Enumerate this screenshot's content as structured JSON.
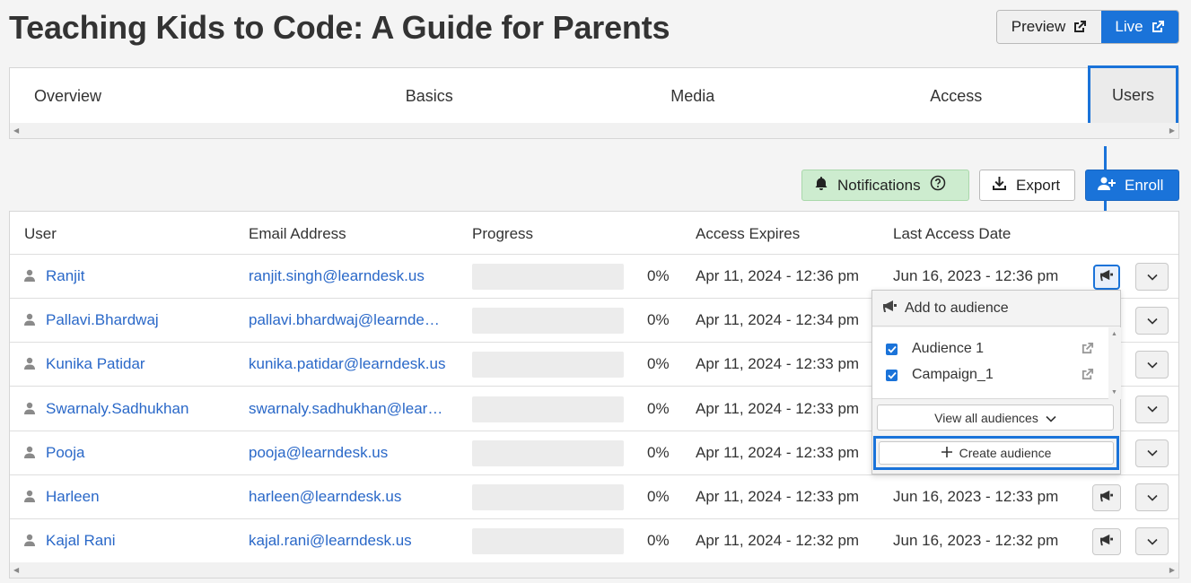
{
  "page": {
    "title": "Teaching Kids to Code: A Guide for Parents",
    "preview_label": "Preview",
    "live_label": "Live"
  },
  "tabs": {
    "items": [
      "Overview",
      "Basics",
      "Media",
      "Access"
    ],
    "active": "Users"
  },
  "actions": {
    "notifications_label": "Notifications",
    "export_label": "Export",
    "enroll_label": "Enroll"
  },
  "table": {
    "headers": {
      "user": "User",
      "email": "Email Address",
      "progress": "Progress",
      "expires": "Access Expires",
      "last": "Last Access Date"
    },
    "rows": [
      {
        "user": "Ranjit",
        "email": "ranjit.singh@learndesk.us",
        "progress": "0%",
        "expires": "Apr 11, 2024 - 12:36 pm",
        "last": "Jun 16, 2023 - 12:36 pm"
      },
      {
        "user": "Pallavi.Bhardwaj",
        "email": "pallavi.bhardwaj@learndesk.us",
        "progress": "0%",
        "expires": "Apr 11, 2024 - 12:34 pm",
        "last": ""
      },
      {
        "user": "Kunika Patidar",
        "email": "kunika.patidar@learndesk.us",
        "progress": "0%",
        "expires": "Apr 11, 2024 - 12:33 pm",
        "last": ""
      },
      {
        "user": "Swarnaly.Sadhukhan",
        "email": "swarnaly.sadhukhan@learndesk.us",
        "progress": "0%",
        "expires": "Apr 11, 2024 - 12:33 pm",
        "last": ""
      },
      {
        "user": "Pooja",
        "email": "pooja@learndesk.us",
        "progress": "0%",
        "expires": "Apr 11, 2024 - 12:33 pm",
        "last": ""
      },
      {
        "user": "Harleen",
        "email": "harleen@learndesk.us",
        "progress": "0%",
        "expires": "Apr 11, 2024 - 12:33 pm",
        "last": "Jun 16, 2023 - 12:33 pm"
      },
      {
        "user": "Kajal Rani",
        "email": "kajal.rani@learndesk.us",
        "progress": "0%",
        "expires": "Apr 11, 2024 - 12:32 pm",
        "last": "Jun 16, 2023 - 12:32 pm"
      }
    ]
  },
  "audience_popup": {
    "title": "Add to audience",
    "items": [
      {
        "label": "Audience 1",
        "checked": true
      },
      {
        "label": "Campaign_1",
        "checked": true
      }
    ],
    "view_all_label": "View all audiences",
    "create_label": "Create audience"
  },
  "colors": {
    "accent": "#1a73d9",
    "link": "#2a68c8",
    "notification_bg": "#cdeccf"
  }
}
